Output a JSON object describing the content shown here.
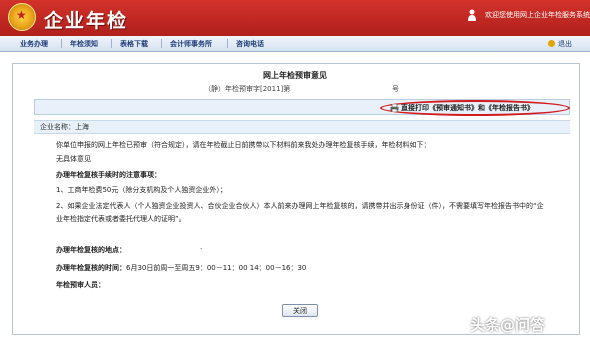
{
  "header": {
    "brand": "企业年检",
    "welcome": "欢迎您使用网上企业年检服务系统"
  },
  "nav": {
    "items": [
      "业务办理",
      "年检须知",
      "表格下载",
      "会计师事务所",
      "咨询电话"
    ],
    "exit": "退出"
  },
  "document": {
    "title": "网上年检预审意见",
    "number_prefix": "（静）年检预审字[2011]第",
    "number_suffix": "号",
    "print_link": "直接打印《预审通知书》和《年检报告书》",
    "company_label": "企业名称：上海",
    "intro": "你单位申报的网上年检已预审（符合规定），请在年检截止日前携带以下材料前来我处办理年检复核手续，年检材料如下：",
    "no_opinion": "无具体意见",
    "notes_heading": "办理年检复核手续时的注意事项：",
    "note1": "1、工商年检费50元（除分支机构及个人独资企业外）；",
    "note2a": "2、如果企业法定代表人（个人独资企业投资人、合伙企业合伙人）本人前来办理网上年检复核的，请携带并出示身份证（件），不需要填写年检报告书中的“企",
    "note2b": "业年检指定代表或者委托代理人的证明”。",
    "location_label": "办理年检复核的地点：",
    "location_value": "·",
    "time_label": "办理年检复核的时间：",
    "time_value": "6月30日前周一至周五9：00－11：00 14：00－16：30",
    "reviewer_label": "年检预审人员：",
    "close_button": "关闭"
  },
  "watermark": "头条@问答",
  "colors": {
    "header_red": "#c0251f",
    "nav_text": "#1d3d78",
    "highlight_oval": "#d11a1a",
    "row_bg": "#e8f0f9"
  }
}
